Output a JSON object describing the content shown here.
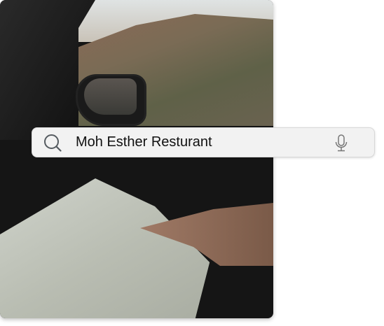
{
  "photo": {
    "alt_subject": "car-interior-map-photo"
  },
  "search": {
    "value": "Moh Esther Resturant",
    "icons": {
      "left": "search-icon",
      "right": "microphone-icon"
    }
  },
  "colors": {
    "search_background": "#f2f2f2",
    "icon": "#555b60"
  }
}
